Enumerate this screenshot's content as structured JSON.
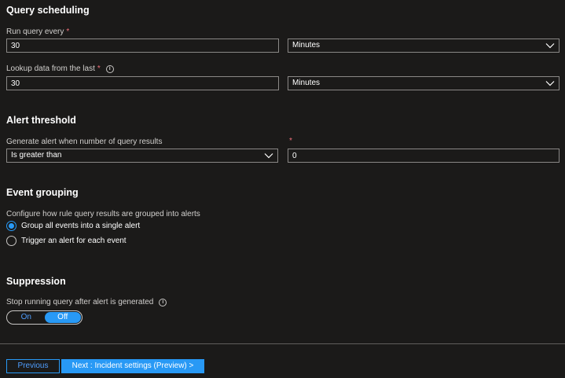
{
  "colors": {
    "background": "#1b1a19",
    "accent": "#2899f5",
    "required": "#f1707b",
    "border": "#8a8886"
  },
  "scheduling": {
    "title": "Query scheduling",
    "run_every": {
      "label": "Run query every",
      "required": "*",
      "value": "30",
      "unit": "Minutes"
    },
    "lookup": {
      "label": "Lookup data from the last",
      "required": "*",
      "value": "30",
      "unit": "Minutes",
      "info_icon": "info-icon"
    }
  },
  "threshold": {
    "title": "Alert threshold",
    "label": "Generate alert when number of query results",
    "operator": "Is greater than",
    "required": "*",
    "value": "0"
  },
  "grouping": {
    "title": "Event grouping",
    "label": "Configure how rule query results are grouped into alerts",
    "options": [
      {
        "label": "Group all events into a single alert",
        "selected": true
      },
      {
        "label": "Trigger an alert for each event",
        "selected": false
      }
    ]
  },
  "suppression": {
    "title": "Suppression",
    "label": "Stop running query after alert is generated",
    "on_label": "On",
    "off_label": "Off",
    "selected": "Off"
  },
  "footer": {
    "previous_label": "Previous",
    "next_label": "Next : Incident settings (Preview) >"
  }
}
